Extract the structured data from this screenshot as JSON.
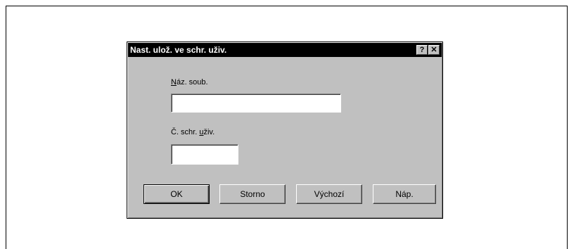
{
  "dialog": {
    "title": "Nast. ulož. ve schr. uživ.",
    "help_button": "?",
    "close_button": "✕"
  },
  "fields": {
    "filename": {
      "label_accel": "N",
      "label_rest": "áz. soub.",
      "value": ""
    },
    "box_number": {
      "label_pre": "Č. schr. ",
      "label_accel": "u",
      "label_rest": "živ.",
      "value": ""
    }
  },
  "buttons": {
    "ok": "OK",
    "cancel": "Storno",
    "default": "Výchozí",
    "help": "Náp."
  },
  "colors": {
    "dialog_face": "#c0c0c0",
    "titlebar": "#000000",
    "title_text": "#ffffff"
  }
}
